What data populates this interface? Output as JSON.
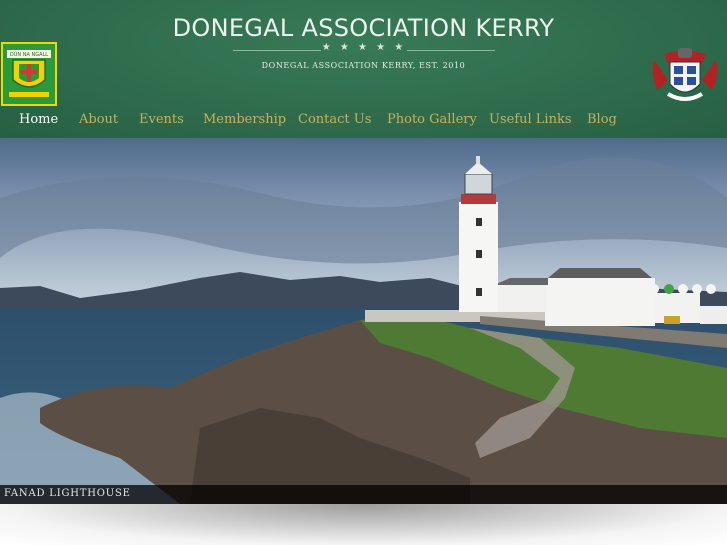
{
  "header": {
    "title": "DONEGAL ASSOCIATION KERRY",
    "stars": "★ ★ ★ ★ ★",
    "tagline": "DONEGAL ASSOCIATION KERRY, EST. 2010",
    "left_crest_text": "DÚN NA NGALL"
  },
  "nav": {
    "items": [
      {
        "label": "Home",
        "active": true
      },
      {
        "label": "About"
      },
      {
        "label": "Events"
      },
      {
        "label": "Membership"
      },
      {
        "label": "Contact Us"
      },
      {
        "label": "Photo Gallery"
      },
      {
        "label": "Useful Links"
      },
      {
        "label": "Blog"
      }
    ]
  },
  "slider": {
    "caption": "FANAD LIGHTHOUSE",
    "slide_count": 5,
    "active_slide": 2
  },
  "colors": {
    "header_green": "#2e6b4c",
    "nav_gold": "#c8b15a",
    "active_dot": "#3fa346"
  }
}
